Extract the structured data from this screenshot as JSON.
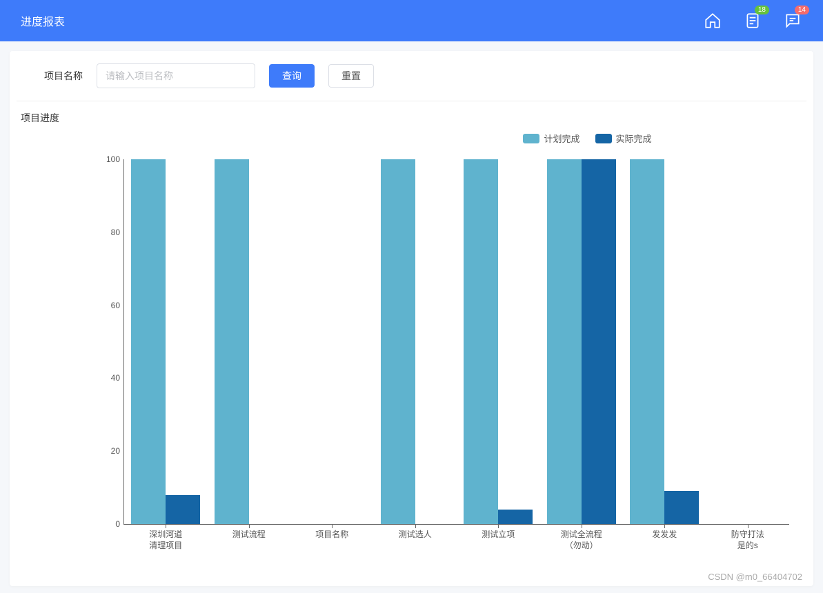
{
  "header": {
    "title": "进度报表",
    "badge_doc": "18",
    "badge_msg": "14"
  },
  "search": {
    "label": "项目名称",
    "placeholder": "请输入项目名称",
    "query_btn": "查询",
    "reset_btn": "重置"
  },
  "section_title": "项目进度",
  "legend_plan": "计划完成",
  "legend_actual": "实际完成",
  "colors": {
    "plan": "#5fb3ce",
    "actual": "#1565a5"
  },
  "chart_data": {
    "type": "bar",
    "xlabel": "",
    "ylabel": "",
    "ylim": [
      0,
      100
    ],
    "yticks": [
      0,
      20,
      40,
      60,
      80,
      100
    ],
    "categories": [
      "深圳河道清理项目",
      "测试流程",
      "项目名称",
      "测试选人",
      "测试立项",
      "测试全流程（勿动）",
      "发发发",
      "防守打法是的s"
    ],
    "series": [
      {
        "name": "计划完成",
        "values": [
          100,
          100,
          0,
          100,
          100,
          100,
          100,
          0
        ]
      },
      {
        "name": "实际完成",
        "values": [
          8,
          0,
          0,
          0,
          4,
          100,
          9,
          0
        ]
      }
    ]
  },
  "watermark": "CSDN @m0_66404702"
}
